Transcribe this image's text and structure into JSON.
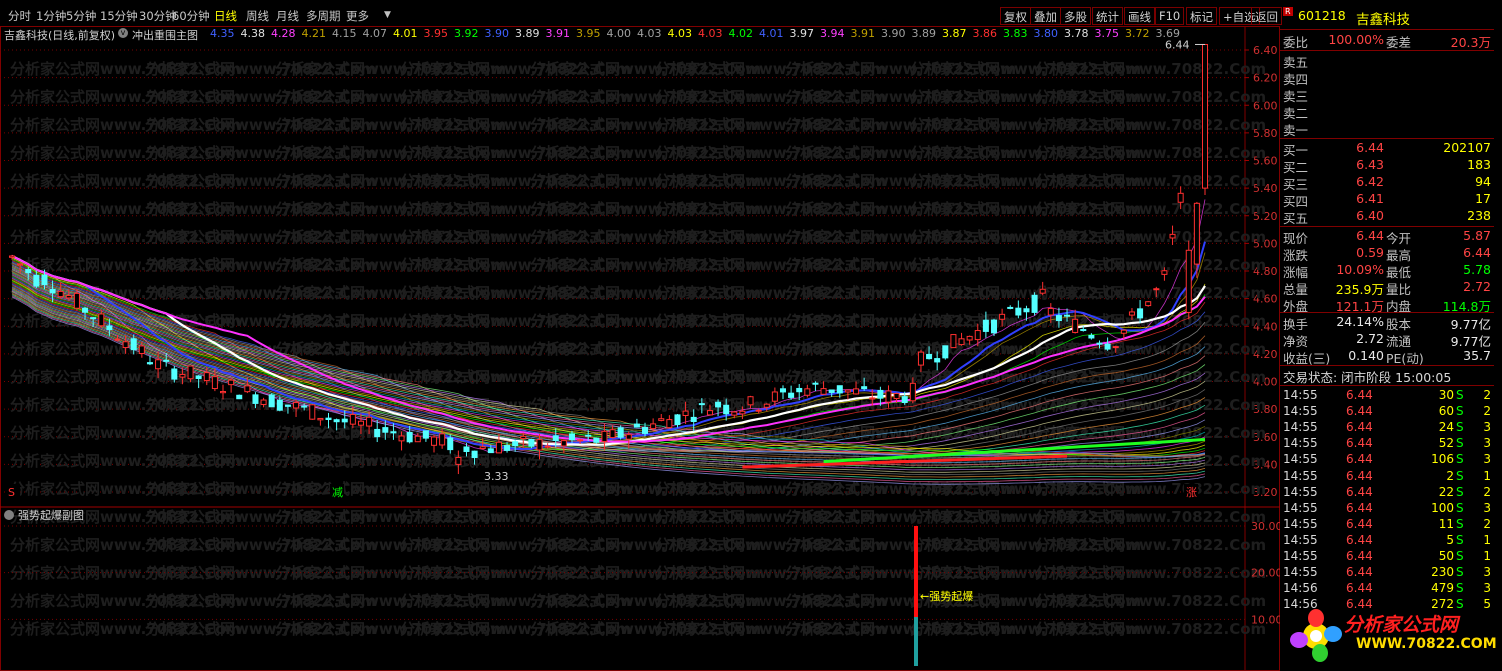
{
  "toolbar": {
    "periods": [
      "分时",
      "1分钟",
      "5分钟",
      "15分钟",
      "30分钟",
      "60分钟",
      "日线",
      "周线",
      "月线",
      "多周期",
      "更多"
    ],
    "active_period": "日线",
    "actions": [
      "复权",
      "叠加",
      "多股",
      "统计",
      "画线",
      "F10",
      "标记",
      "+自选",
      "返回"
    ]
  },
  "main_chart": {
    "stock_label": "吉鑫科技(日线,前复权)",
    "indicator": "冲出重围主图",
    "ma_values": [
      {
        "v": "4.35",
        "c": "#4060ff"
      },
      {
        "v": "4.38",
        "c": "#e0e0e0"
      },
      {
        "v": "4.28",
        "c": "#ff40ff"
      },
      {
        "v": "4.21",
        "c": "#c0a000"
      },
      {
        "v": "4.15",
        "c": "#a0a0a0"
      },
      {
        "v": "4.07",
        "c": "#a0a0a0"
      },
      {
        "v": "4.01",
        "c": "#ffff00"
      },
      {
        "v": "3.95",
        "c": "#ff3030"
      },
      {
        "v": "3.92",
        "c": "#00ff00"
      },
      {
        "v": "3.90",
        "c": "#4060ff"
      },
      {
        "v": "3.89",
        "c": "#e0e0e0"
      },
      {
        "v": "3.91",
        "c": "#ff40ff"
      },
      {
        "v": "3.95",
        "c": "#c0a000"
      },
      {
        "v": "4.00",
        "c": "#a0a0a0"
      },
      {
        "v": "4.03",
        "c": "#a0a0a0"
      },
      {
        "v": "4.03",
        "c": "#ffff00"
      },
      {
        "v": "4.03",
        "c": "#ff3030"
      },
      {
        "v": "4.02",
        "c": "#00ff00"
      },
      {
        "v": "4.01",
        "c": "#4060ff"
      },
      {
        "v": "3.97",
        "c": "#e0e0e0"
      },
      {
        "v": "3.94",
        "c": "#ff40ff"
      },
      {
        "v": "3.91",
        "c": "#c0a000"
      },
      {
        "v": "3.90",
        "c": "#a0a0a0"
      },
      {
        "v": "3.89",
        "c": "#a0a0a0"
      },
      {
        "v": "3.87",
        "c": "#ffff00"
      },
      {
        "v": "3.86",
        "c": "#ff3030"
      },
      {
        "v": "3.83",
        "c": "#00ff00"
      },
      {
        "v": "3.80",
        "c": "#4060ff"
      },
      {
        "v": "3.78",
        "c": "#e0e0e0"
      },
      {
        "v": "3.75",
        "c": "#ff40ff"
      },
      {
        "v": "3.72",
        "c": "#c0a000"
      },
      {
        "v": "3.69",
        "c": "#a0a0a0"
      }
    ],
    "y_ticks": [
      "6.40",
      "6.20",
      "6.00",
      "5.80",
      "5.60",
      "5.40",
      "5.20",
      "5.00",
      "4.80",
      "4.60",
      "4.40",
      "4.20",
      "4.00",
      "3.80",
      "3.60",
      "3.40",
      "3.20"
    ],
    "high_label": "6.44",
    "low_label": "3.33",
    "markers": [
      "S",
      "减",
      "涨"
    ],
    "watermark": "分析家公式网www.70822.Com"
  },
  "sub_chart": {
    "indicator": "强势起爆副图",
    "annotation": "←强势起爆",
    "y_ticks": [
      "30.00",
      "20.00",
      "10.00"
    ]
  },
  "quote": {
    "code": "601218",
    "name": "吉鑫科技",
    "weibi_label": "委比",
    "weibi": "100.00%",
    "weicha_label": "委差",
    "weicha": "20.3万",
    "sell": [
      {
        "label": "卖五",
        "price": "",
        "vol": ""
      },
      {
        "label": "卖四",
        "price": "",
        "vol": ""
      },
      {
        "label": "卖三",
        "price": "",
        "vol": ""
      },
      {
        "label": "卖二",
        "price": "",
        "vol": ""
      },
      {
        "label": "卖一",
        "price": "",
        "vol": ""
      }
    ],
    "buy": [
      {
        "label": "买一",
        "price": "6.44",
        "vol": "202107"
      },
      {
        "label": "买二",
        "price": "6.43",
        "vol": "183"
      },
      {
        "label": "买三",
        "price": "6.42",
        "vol": "94"
      },
      {
        "label": "买四",
        "price": "6.41",
        "vol": "17"
      },
      {
        "label": "买五",
        "price": "6.40",
        "vol": "238"
      }
    ],
    "stats": [
      {
        "l1": "现价",
        "v1": "6.44",
        "c1": "red",
        "l2": "今开",
        "v2": "5.87",
        "c2": "red"
      },
      {
        "l1": "涨跌",
        "v1": "0.59",
        "c1": "red",
        "l2": "最高",
        "v2": "6.44",
        "c2": "red"
      },
      {
        "l1": "涨幅",
        "v1": "10.09%",
        "c1": "red",
        "l2": "最低",
        "v2": "5.78",
        "c2": "grn"
      },
      {
        "l1": "总量",
        "v1": "235.9万",
        "c1": "yel",
        "l2": "量比",
        "v2": "2.72",
        "c2": "red"
      },
      {
        "l1": "外盘",
        "v1": "121.1万",
        "c1": "red",
        "l2": "内盘",
        "v2": "114.8万",
        "c2": "grn"
      }
    ],
    "fund": [
      {
        "l1": "换手",
        "v1": "24.14%",
        "l2": "股本",
        "v2": "9.77亿"
      },
      {
        "l1": "净资",
        "v1": "2.72",
        "l2": "流通",
        "v2": "9.77亿"
      },
      {
        "l1": "收益(三)",
        "v1": "0.140",
        "l2": "PE(动)",
        "v2": "35.7"
      }
    ],
    "trade_status": "交易状态: 闭市阶段 15:00:05",
    "ticks": [
      {
        "t": "14:55",
        "p": "6.44",
        "q": "30",
        "s": "S",
        "n": "2"
      },
      {
        "t": "14:55",
        "p": "6.44",
        "q": "60",
        "s": "S",
        "n": "2"
      },
      {
        "t": "14:55",
        "p": "6.44",
        "q": "24",
        "s": "S",
        "n": "3"
      },
      {
        "t": "14:55",
        "p": "6.44",
        "q": "52",
        "s": "S",
        "n": "3"
      },
      {
        "t": "14:55",
        "p": "6.44",
        "q": "106",
        "s": "S",
        "n": "3"
      },
      {
        "t": "14:55",
        "p": "6.44",
        "q": "2",
        "s": "S",
        "n": "1"
      },
      {
        "t": "14:55",
        "p": "6.44",
        "q": "22",
        "s": "S",
        "n": "2"
      },
      {
        "t": "14:55",
        "p": "6.44",
        "q": "100",
        "s": "S",
        "n": "3"
      },
      {
        "t": "14:55",
        "p": "6.44",
        "q": "11",
        "s": "S",
        "n": "2"
      },
      {
        "t": "14:55",
        "p": "6.44",
        "q": "5",
        "s": "S",
        "n": "1"
      },
      {
        "t": "14:55",
        "p": "6.44",
        "q": "50",
        "s": "S",
        "n": "1"
      },
      {
        "t": "14:55",
        "p": "6.44",
        "q": "230",
        "s": "S",
        "n": "3"
      },
      {
        "t": "14:56",
        "p": "6.44",
        "q": "479",
        "s": "S",
        "n": "3"
      },
      {
        "t": "14:56",
        "p": "6.44",
        "q": "272",
        "s": "S",
        "n": "5"
      }
    ]
  },
  "logo": {
    "title": "分析家公式网",
    "url": "WWW.70822.COM"
  }
}
